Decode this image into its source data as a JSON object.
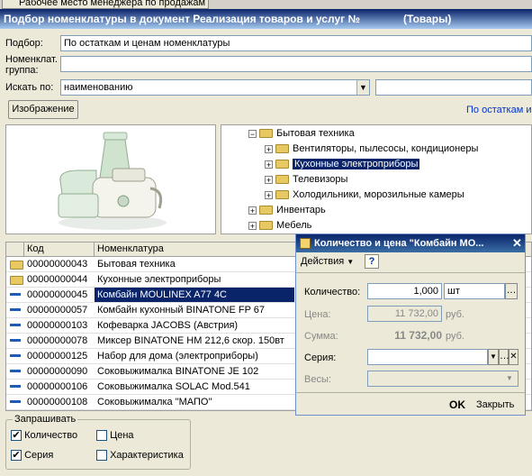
{
  "top_tab": {
    "label": "Рабочее место менеджера по продажам"
  },
  "window": {
    "title": "Подбор номенклатуры в документ Реализация товаров и услуг №",
    "subtitle": "(Товары)"
  },
  "filters": {
    "podbor_label": "Подбор:",
    "podbor_value": "По остаткам и ценам номенклатуры",
    "nomenkl_label_1": "Номенклат.",
    "nomenkl_label_2": "группа:",
    "nomenkl_value": "",
    "search_label": "Искать по:",
    "search_value": "наименованию",
    "search_text": "",
    "image_button": "Изображение",
    "mode_link": "По остаткам и"
  },
  "tree": {
    "items": [
      {
        "label": "Бытовая техника",
        "sign": "−"
      },
      {
        "label": "Вентиляторы, пылесосы, кондиционеры",
        "sign": "+"
      },
      {
        "label": "Кухонные электроприборы",
        "sign": "+"
      },
      {
        "label": "Телевизоры",
        "sign": "+"
      },
      {
        "label": "Холодильники, морозильные камеры",
        "sign": "+"
      },
      {
        "label": "Инвентарь",
        "sign": "+"
      },
      {
        "label": "Мебель",
        "sign": "+"
      }
    ]
  },
  "table": {
    "col_code": "Код",
    "col_name": "Номенклатура",
    "rows": [
      {
        "type": "folder",
        "code": "00000000043",
        "name": "Бытовая техника"
      },
      {
        "type": "folder",
        "code": "00000000044",
        "name": "Кухонные электроприборы"
      },
      {
        "type": "item",
        "code": "00000000045",
        "name": "Комбайн MOULINEX A77 4C",
        "selected": true
      },
      {
        "type": "item",
        "code": "00000000057",
        "name": "Комбайн кухонный BINATONE FP 67"
      },
      {
        "type": "item",
        "code": "00000000103",
        "name": "Кофеварка JACOBS (Австрия)"
      },
      {
        "type": "item",
        "code": "00000000078",
        "name": "Миксер BINATONE HM 212,6 скор. 150вт"
      },
      {
        "type": "item",
        "code": "00000000125",
        "name": "Набор для дома (электроприборы)"
      },
      {
        "type": "item",
        "code": "00000000090",
        "name": "Соковыжималка  BINATONE JE 102"
      },
      {
        "type": "item",
        "code": "00000000106",
        "name": "Соковыжималка  SOLAC  Mod.541"
      },
      {
        "type": "item",
        "code": "00000000108",
        "name": "Соковыжималка \"МАПО\""
      }
    ]
  },
  "ask": {
    "title": "Запрашивать",
    "qty": "Количество",
    "price": "Цена",
    "series": "Серия",
    "char": "Характеристика"
  },
  "dialog": {
    "title": "Количество и цена \"Комбайн MO...",
    "actions": "Действия",
    "help": "?",
    "qty_label": "Количество:",
    "qty_value": "1,000",
    "unit": "шт",
    "price_label": "Цена:",
    "price_value": "11 732,00",
    "currency": "руб.",
    "sum_label": "Сумма:",
    "sum_value": "11 732,00",
    "series_label": "Серия:",
    "weight_label": "Весы:",
    "ok": "OK",
    "close": "Закрыть"
  }
}
